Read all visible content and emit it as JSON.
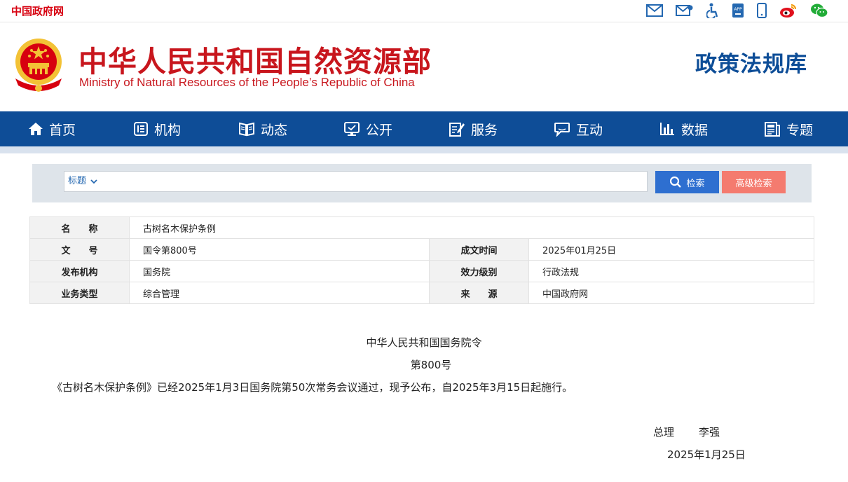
{
  "topbar": {
    "gov_link": "中国政府网",
    "app_label": "APP"
  },
  "header": {
    "site_cn": "中华人民共和国自然资源部",
    "site_en": "Ministry of Natural Resources of the People’s Republic of China",
    "db_title": "政策法规库"
  },
  "nav": {
    "items": [
      {
        "label": "首页",
        "icon": "home-icon"
      },
      {
        "label": "机构",
        "icon": "organization-icon"
      },
      {
        "label": "动态",
        "icon": "book-icon"
      },
      {
        "label": "公开",
        "icon": "monitor-icon"
      },
      {
        "label": "服务",
        "icon": "edit-document-icon"
      },
      {
        "label": "互动",
        "icon": "chat-icon"
      },
      {
        "label": "数据",
        "icon": "bar-chart-icon"
      },
      {
        "label": "专题",
        "icon": "newspaper-icon"
      }
    ]
  },
  "search": {
    "field_selected": "标题",
    "value": "",
    "search_label": "检索",
    "advanced_label": "高级检索"
  },
  "meta": {
    "name_label": "名　　称",
    "name_value": "古树名木保护条例",
    "docno_label": "文　　号",
    "docno_value": "国令第800号",
    "date_label": "成文时间",
    "date_value": "2025年01月25日",
    "issuer_label": "发布机构",
    "issuer_value": "国务院",
    "level_label": "效力级别",
    "level_value": "行政法规",
    "category_label": "业务类型",
    "category_value": "综合管理",
    "source_label": "来　　源",
    "source_value": "中国政府网"
  },
  "doc": {
    "title": "中华人民共和国国务院令",
    "number": "第800号",
    "paragraph": "《古树名木保护条例》已经2025年1月3日国务院第50次常务会议通过，现予公布，自2025年3月15日起施行。",
    "sign_role": "总理",
    "sign_name": "李强",
    "sign_date": "2025年1月25日"
  },
  "colors": {
    "nav_blue": "#0e4d97",
    "brand_red": "#c8161d",
    "search_blue": "#2e6fd0",
    "advanced_salmon": "#f47b6f"
  }
}
